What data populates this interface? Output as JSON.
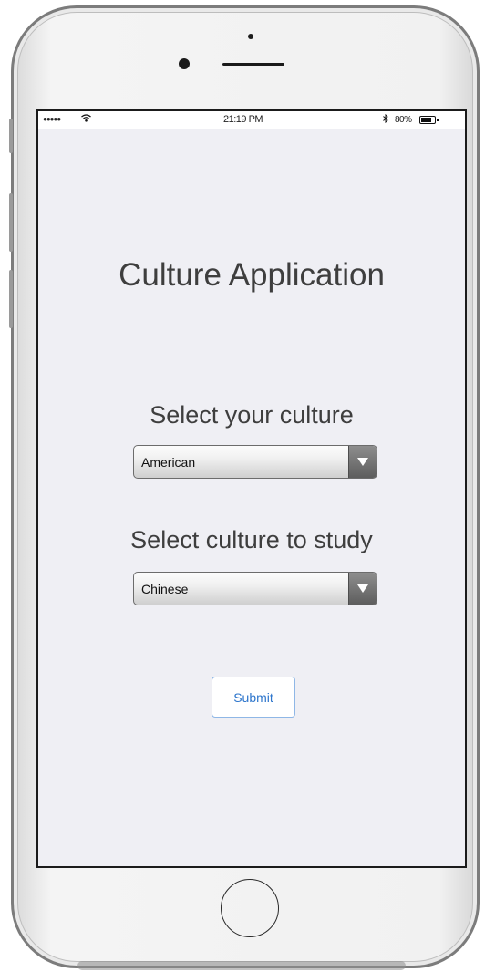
{
  "status_bar": {
    "signal": "●●●●●",
    "wifi_icon": "wifi-icon",
    "time": "21:19 PM",
    "bluetooth_icon": "bluetooth-icon",
    "battery_percent": "80%"
  },
  "app": {
    "title": "Culture Application",
    "your_culture_label": "Select your culture",
    "your_culture_value": "American",
    "study_culture_label": "Select culture to study",
    "study_culture_value": "Chinese",
    "submit_label": "Submit"
  },
  "colors": {
    "screen_bg": "#efeff4",
    "submit_text": "#2e76cc",
    "submit_border": "#8fb7e6"
  }
}
